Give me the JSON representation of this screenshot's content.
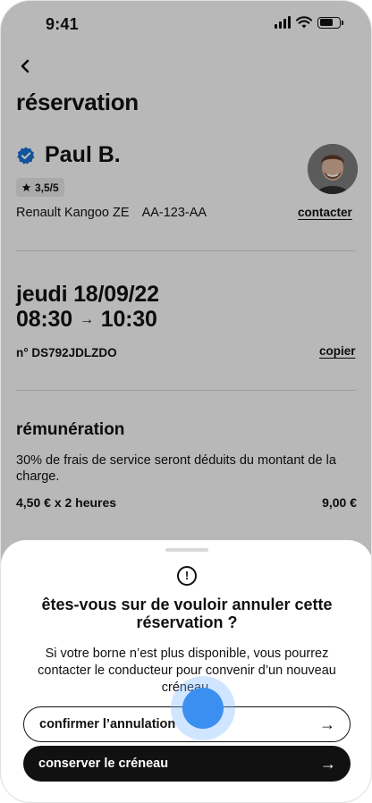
{
  "status_bar": {
    "time": "9:41"
  },
  "header": {
    "back_icon": "chevron-left-icon",
    "title": "réservation"
  },
  "driver": {
    "name": "Paul B.",
    "verified_icon": "verified-badge-icon",
    "rating": "3,5/5",
    "vehicle_model": "Renault Kangoo ZE",
    "plate": "AA-123-AA",
    "contact_label": "contacter"
  },
  "booking": {
    "date": "jeudi 18/09/22",
    "start_time": "08:30",
    "arrow": "→",
    "end_time": "10:30",
    "reference": "n° DS792JDLZDO",
    "copy_label": "copier"
  },
  "remuneration": {
    "title": "rémunération",
    "description": "30% de frais de service seront déduits du montant de la charge.",
    "rate_label": "4,50 € x 2 heures",
    "total": "9,00 €"
  },
  "modal": {
    "icon": "alert-circle-icon",
    "title": "êtes-vous sur de vouloir annuler cette réservation ?",
    "text": "Si votre borne n’est plus disponible, vous pourrez contacter le conducteur pour convenir d’un nouveau créneau.",
    "confirm_label": "confirmer l’annulation",
    "keep_label": "conserver le créneau",
    "arrow": "→"
  },
  "colors": {
    "verified": "#1a6fd1",
    "primary_dark": "#111111",
    "tap_indicator": "#3b8ff0"
  }
}
